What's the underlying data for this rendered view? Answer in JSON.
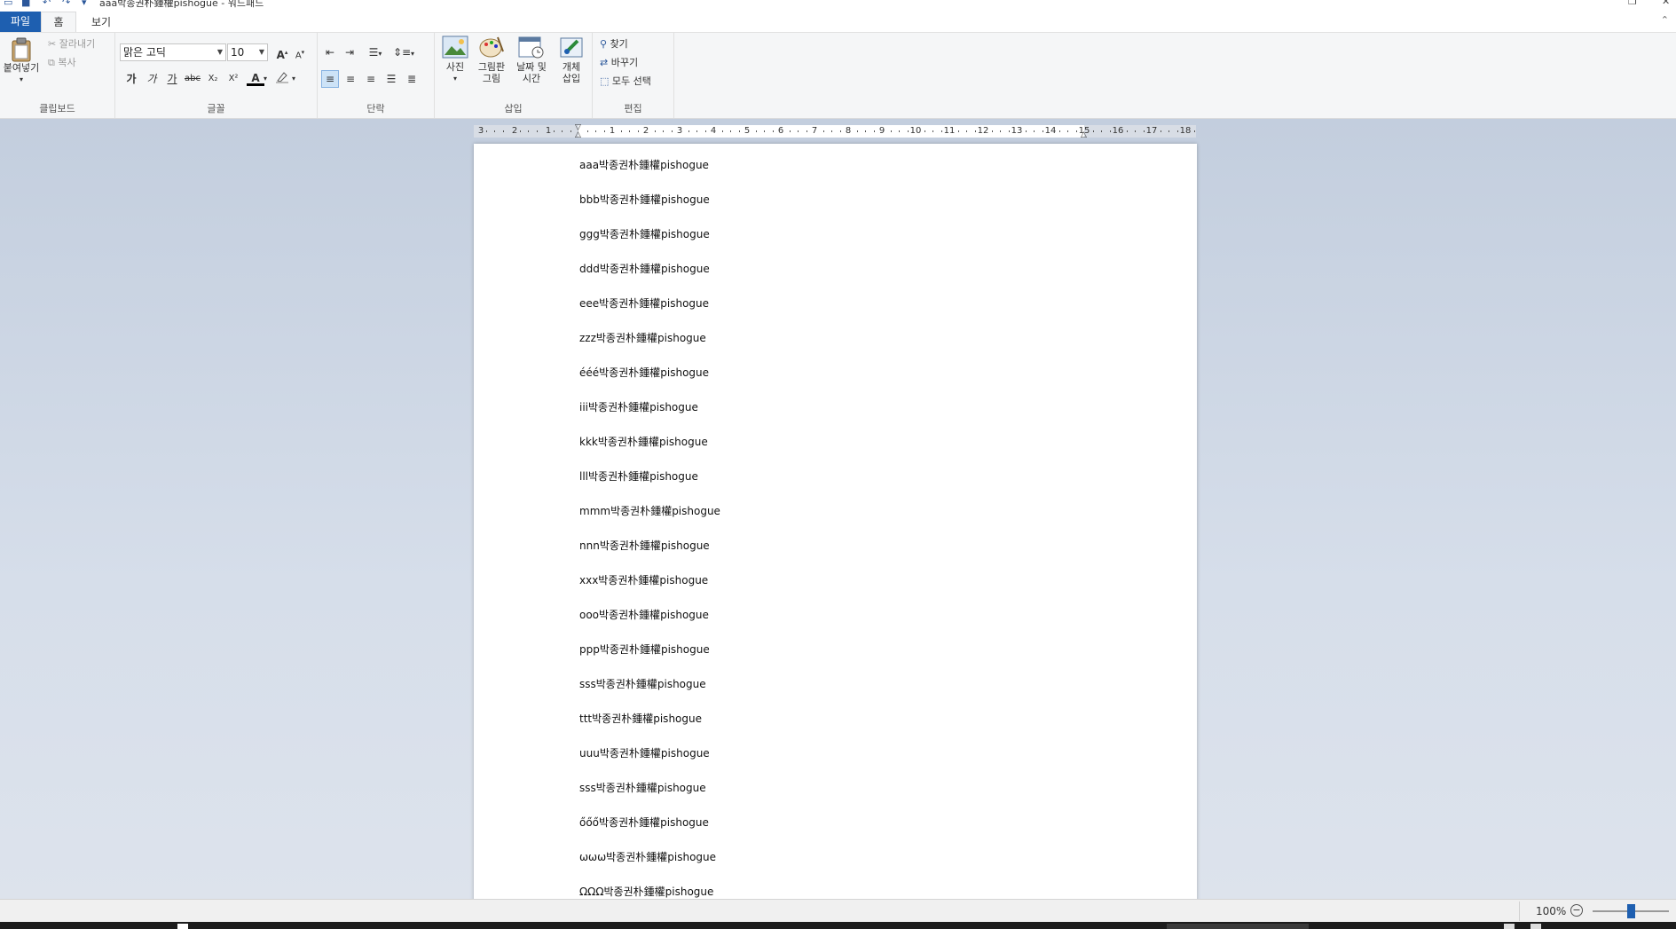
{
  "window": {
    "title": "aaa박종권朴鍾權pishogue - 워드패드"
  },
  "tabs": {
    "file": "파일",
    "home": "홈",
    "view": "보기"
  },
  "clipboard": {
    "paste": "붙여넣기",
    "cut": "잘라내기",
    "copy": "복사",
    "label": "클립보드"
  },
  "font": {
    "family": "맑은 고딕",
    "size": "10",
    "grow": "A",
    "shrink": "A",
    "bold": "가",
    "italic": "가",
    "underline": "가",
    "strike": "abc",
    "subscript": "X₂",
    "superscript": "X²",
    "color_letter": "A",
    "label": "글꼴"
  },
  "paragraph": {
    "label": "단락"
  },
  "insert": {
    "picture": "사진",
    "paint1": "그림판",
    "paint2": "그림",
    "datetime1": "날짜 및",
    "datetime2": "시간",
    "object1": "개체",
    "object2": "삽입",
    "label": "삽입"
  },
  "editing": {
    "find": "찾기",
    "replace": "바꾸기",
    "select_all": "모두 선택",
    "label": "편집"
  },
  "ruler": {
    "left_numbers": [
      "3",
      "2",
      "1"
    ],
    "right_numbers": [
      "1",
      "2",
      "3",
      "4",
      "5",
      "6",
      "7",
      "8",
      "9",
      "10",
      "11",
      "12",
      "13",
      "14",
      "15",
      "16",
      "17",
      "18"
    ]
  },
  "document": {
    "lines": [
      "aaa박종권朴鍾權pishogue",
      "bbb박종권朴鍾權pishogue",
      "ggg박종권朴鍾權pishogue",
      "ddd박종권朴鍾權pishogue",
      "eee박종권朴鍾權pishogue",
      "zzz박종권朴鍾權pishogue",
      "ééé박종권朴鍾權pishogue",
      "iii박종권朴鍾權pishogue",
      "kkk박종권朴鍾權pishogue",
      "lll박종권朴鍾權pishogue",
      "mmm박종권朴鍾權pishogue",
      "nnn박종권朴鍾權pishogue",
      "xxx박종권朴鍾權pishogue",
      "ooo박종권朴鍾權pishogue",
      "ppp박종권朴鍾權pishogue",
      "sss박종권朴鍾權pishogue",
      "ttt박종권朴鍾權pishogue",
      "uuu박종권朴鍾權pishogue",
      "sss박종권朴鍾權pishogue",
      "őőő박종권朴鍾權pishogue",
      "ωωω박종권朴鍾權pishogue",
      "ΩΩΩ박종권朴鍾權pishogue"
    ]
  },
  "status": {
    "zoom": "100%",
    "zoom_level": 0.5
  },
  "colors": {
    "accent": "#1e5fb0",
    "ribbon_bg": "#f5f6f7",
    "canvas_bg": "#c9d3e2"
  }
}
